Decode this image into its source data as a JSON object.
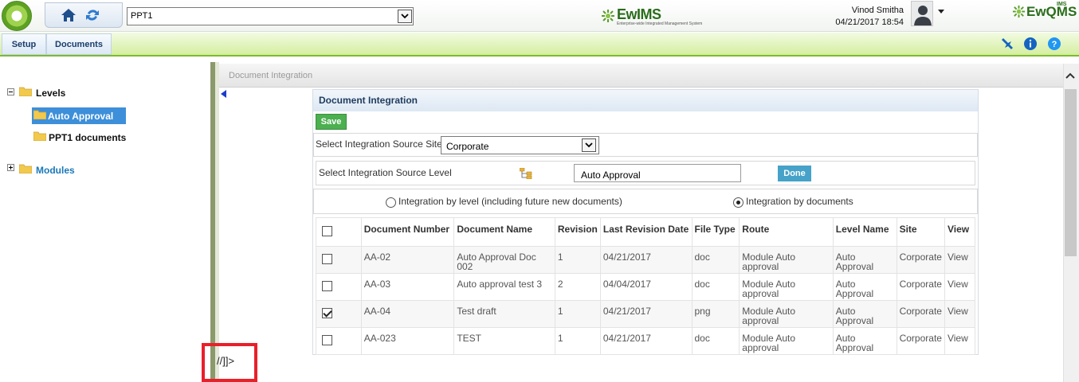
{
  "topbar": {
    "project_select_value": "PPT1",
    "brand_name": "EwIMS",
    "brand_tagline": "Enterprise-wide Integrated Management System",
    "user_name": "Vinod Smitha",
    "datetime": "04/21/2017 18:54",
    "right_brand": "EwQMS",
    "right_brand_sup": "IMS"
  },
  "menu": {
    "items": [
      {
        "label": "Setup"
      },
      {
        "label": "Documents"
      }
    ]
  },
  "tree": {
    "levels_label": "Levels",
    "auto_approval_label": "Auto Approval",
    "ppt1_documents_label": "PPT1 documents",
    "modules_label": "Modules"
  },
  "breadcrumb": {
    "item": "Document Integration"
  },
  "panel": {
    "title": "Document Integration",
    "save_label": "Save",
    "site_label": "Select Integration Source Site",
    "site_value": "Corporate",
    "level_label": "Select Integration Source Level",
    "level_value": "Auto Approval",
    "done_label": "Done",
    "radio_level_label": "Integration by level (including future new documents)",
    "radio_documents_label": "Integration by documents",
    "selected_mode": "documents"
  },
  "table": {
    "headers": {
      "doc_number": "Document Number",
      "doc_name": "Document Name",
      "revision": "Revision",
      "last_revision_date": "Last Revision Date",
      "file_type": "File Type",
      "route": "Route",
      "level_name": "Level Name",
      "site": "Site",
      "view": "View"
    },
    "rows": [
      {
        "checked": false,
        "doc_number": "AA-02",
        "doc_name": "Auto Approval Doc 002",
        "revision": "1",
        "date": "04/21/2017",
        "file_type": "doc",
        "route": "Module Auto approval",
        "level_name": "Auto Approval",
        "site": "Corporate",
        "view": "View"
      },
      {
        "checked": false,
        "doc_number": "AA-03",
        "doc_name": "Auto approval test 3",
        "revision": "2",
        "date": "04/04/2017",
        "file_type": "doc",
        "route": "Module Auto approval",
        "level_name": "Auto Approval",
        "site": "Corporate",
        "view": "View"
      },
      {
        "checked": true,
        "doc_number": "AA-04",
        "doc_name": "Test draft",
        "revision": "1",
        "date": "04/21/2017",
        "file_type": "png",
        "route": "Module Auto approval",
        "level_name": "Auto Approval",
        "site": "Corporate",
        "view": "View"
      },
      {
        "checked": false,
        "doc_number": "AA-023",
        "doc_name": "TEST",
        "revision": "1",
        "date": "04/21/2017",
        "file_type": "doc",
        "route": "Module Auto approval",
        "level_name": "Auto Approval",
        "site": "Corporate",
        "view": "View"
      }
    ]
  },
  "stray_text": "//]]>",
  "colors": {
    "accent_green": "#7cba2f",
    "link_blue": "#1a78b8",
    "selected_blue": "#3d8fd9",
    "highlight_red": "#e8202a"
  }
}
